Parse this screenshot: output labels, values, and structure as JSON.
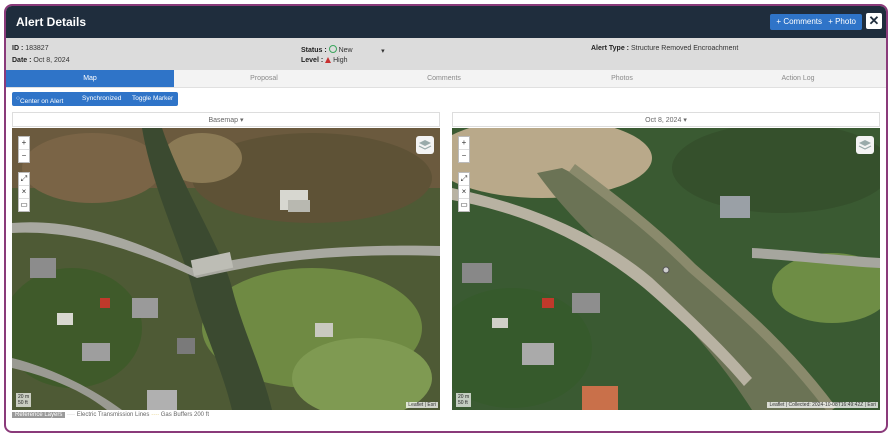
{
  "window": {
    "title": "Alert Details",
    "comments_label": "+ Comments",
    "photo_label": "+ Photo",
    "close_label": "✕"
  },
  "info": {
    "id_label": "ID :",
    "id_value": "183827",
    "date_label": "Date :",
    "date_value": "Oct 8, 2024",
    "status_label": "Status :",
    "status_value": "New",
    "level_label": "Level :",
    "level_value": "High",
    "type_label": "Alert Type :",
    "type_value": "Structure Removed Encroachment"
  },
  "tabs": [
    "Map",
    "Proposal",
    "Comments",
    "Photos",
    "Action Log"
  ],
  "toolbar": {
    "center": "Center on Alert",
    "sync": "Synchronized",
    "toggle": "Toggle Marker"
  },
  "left_map": {
    "selector": "Basemap",
    "scale_top": "20 m",
    "scale_bottom": "50 ft",
    "attribution": "Leaflet | Esri"
  },
  "right_map": {
    "selector": "Oct 8, 2024",
    "scale_top": "20 m",
    "scale_bottom": "50 ft",
    "attribution": "Leaflet | Collected: 2024-10-08T16:49:42Z | Esri"
  },
  "map_controls": {
    "zoom_in": "+",
    "zoom_out": "−",
    "expand": "⤢",
    "close": "×",
    "measure": "▭"
  },
  "reference": {
    "label": "Reference Layers",
    "line1": "Electric Transmission Lines",
    "line2": "Gas Buffers 200 ft"
  },
  "colors": {
    "header": "#1f2d3d",
    "accent": "#2f74c8",
    "frame": "#8a3a7a"
  }
}
